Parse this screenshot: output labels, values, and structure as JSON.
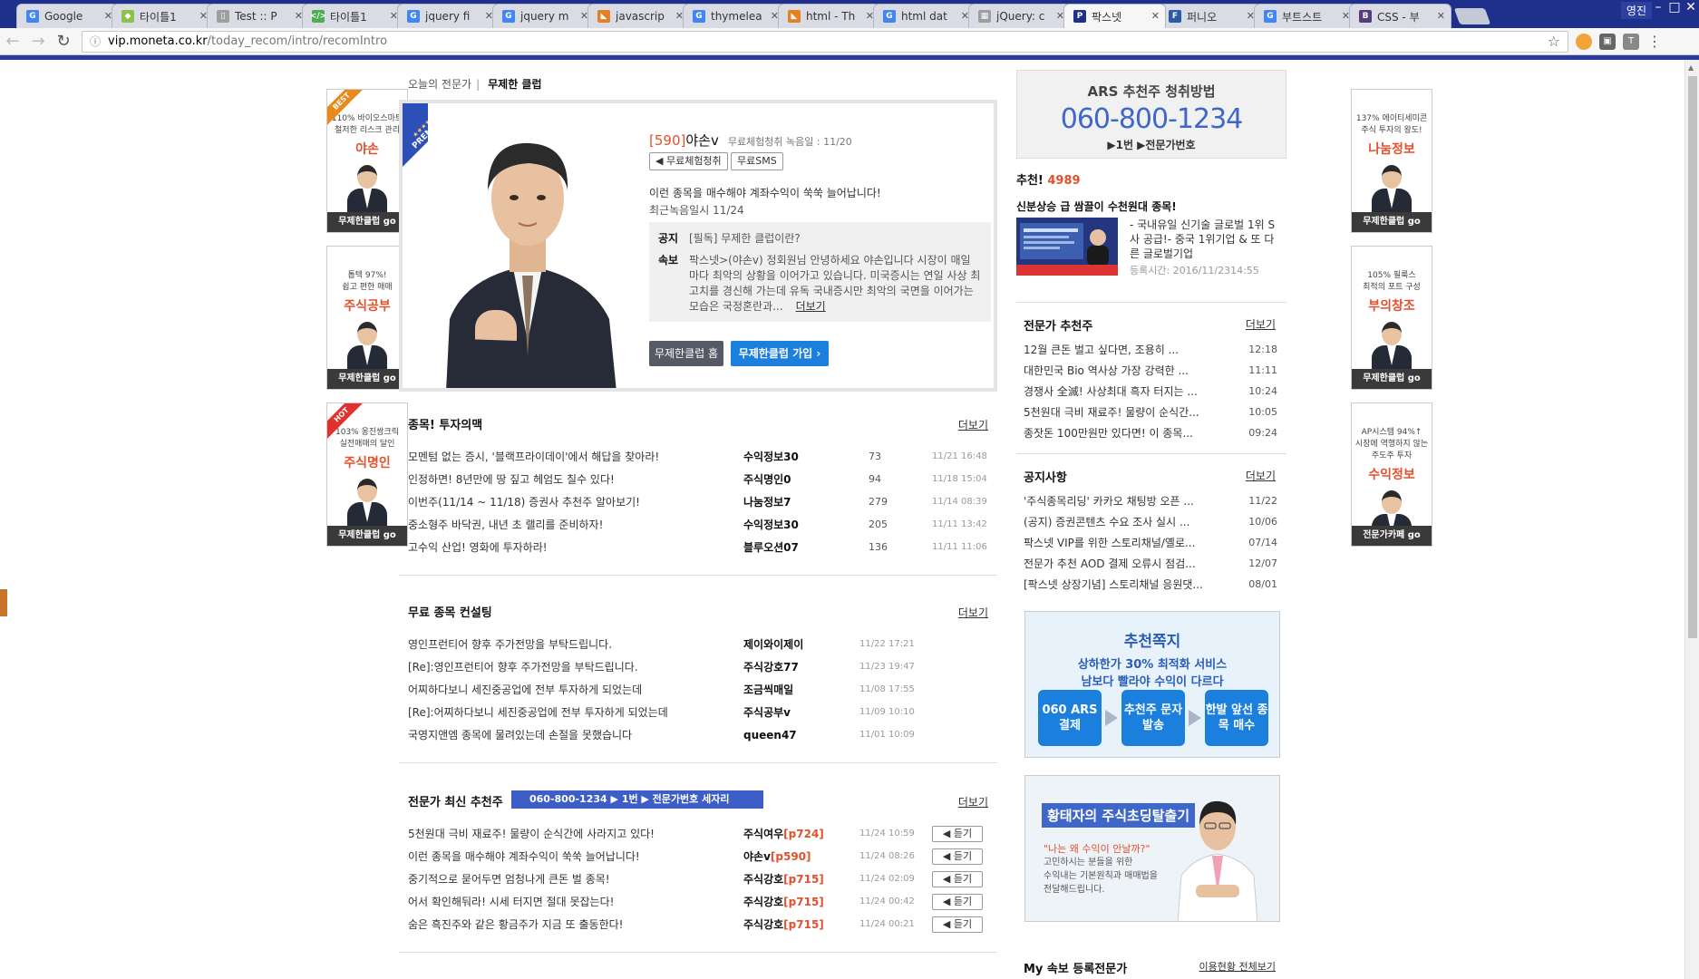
{
  "browser": {
    "tabs": [
      {
        "title": "Google",
        "icon": "G",
        "color": "#4285f4"
      },
      {
        "title": "타이틀1",
        "icon": "◆",
        "color": "#8bc34a"
      },
      {
        "title": "Test :: P",
        "icon": "▯",
        "color": "#9e9e9e"
      },
      {
        "title": "타이틀1",
        "icon": "</>",
        "color": "#4caf50"
      },
      {
        "title": "jquery fi",
        "icon": "G",
        "color": "#4285f4"
      },
      {
        "title": "jquery m",
        "icon": "G",
        "color": "#4285f4"
      },
      {
        "title": "javascrip",
        "icon": "◣",
        "color": "#e67e22"
      },
      {
        "title": "thymelea",
        "icon": "G",
        "color": "#4285f4"
      },
      {
        "title": "html - Th",
        "icon": "◣",
        "color": "#e67e22"
      },
      {
        "title": "html dat",
        "icon": "G",
        "color": "#4285f4"
      },
      {
        "title": "jQuery: c",
        "icon": "▦",
        "color": "#9e9e9e"
      },
      {
        "title": "팍스넷 ",
        "icon": "P",
        "color": "#1f2f8c",
        "active": true
      },
      {
        "title": "퍼니오 ",
        "icon": "F",
        "color": "#2b5aa8"
      },
      {
        "title": "부트스트",
        "icon": "G",
        "color": "#4285f4"
      },
      {
        "title": "CSS - 부",
        "icon": "B",
        "color": "#563d7c"
      }
    ],
    "profile": "영진",
    "url_host": "vip.moneta.co.kr",
    "url_path": "/today_recom/intro/recomIntro"
  },
  "breadcrumb": {
    "parent": "오늘의 전문가",
    "current": "무제한 클럽"
  },
  "side_left": [
    {
      "badge": "BEST",
      "badge_color": "#e88a1a",
      "line1": "110% 바이오스마트",
      "line2": "철저한 리스크 관리",
      "name": "야손",
      "go": "무제한클럽 go"
    },
    {
      "badge": "",
      "badge_color": "",
      "line1": "톱텍 97%!",
      "line2": "쉽고 편한 매매",
      "name": "주식공부",
      "go": "무제한클럽 go"
    },
    {
      "badge": "HOT",
      "badge_color": "#e2302d",
      "line1": "103% 옹진쌍크릭",
      "line2": "실전매매의 달인",
      "name": "주식명인",
      "go": "무제한클럽 go"
    }
  ],
  "side_right": [
    {
      "line1": "137% 에이티세미콘",
      "line2": "주식 투자의 왕도!",
      "name": "나눔정보",
      "go": "무제한클럽 go"
    },
    {
      "line1": "105% 필룩스",
      "line2": "최적의 포트 구성",
      "name": "부의창조",
      "go": "무제한클럽 go"
    },
    {
      "line1": "AP시스템 94%↑",
      "line2": "시장에 역행하지 않는 주도주 투자",
      "name": "수익정보",
      "go": "전문가카페 go"
    }
  ],
  "feature": {
    "premium": "PREMIUM",
    "stars": "★★★★★",
    "num": "[590]",
    "name": "야손v",
    "sub": "무료체험청취 녹음일 : 11/20",
    "btn_listen": "◀ 무료체험청취",
    "btn_sms": "무료SMS",
    "headline": "이런 종목을 매수해야 계좌수익이 쑥쑥 늘어납니다!",
    "recent": "최근녹음일시 11/24",
    "notice_k": "공지",
    "notice_v": "[필독] 무제한 클럽이란?",
    "flash_k": "속보",
    "flash_v": "팍스넷>(야손v) 정회원님 안녕하세요 야손입니다 시장이 매일 마다 최악의 상황을 이어가고 있습니다. 미국증시는 연일 사상 최고치를 경신해 가는데 유독 국내증시만 최악의 국면을 이어가는 모습은 국정혼란과...",
    "more": "더보기",
    "btn_home": "무제한클럽 홈",
    "btn_join": "무제한클럽 가입 ›"
  },
  "sections": {
    "picks": {
      "title": "종목! 투자의맥",
      "more": "더보기",
      "rows": [
        {
          "title": "모멘텀 없는 증시, '블랙프라이데이'에서 해답을 찾아라!",
          "author": "수익정보30",
          "count": "73",
          "date": "11/21 16:48"
        },
        {
          "title": "인정하면! 8년만에 땅 짚고 헤엄도 칠수 있다!",
          "author": "주식명인0",
          "count": "94",
          "date": "11/18 15:04"
        },
        {
          "title": "이번주(11/14 ~ 11/18) 증권사 추천주 알아보기!",
          "author": "나눔정보7",
          "count": "279",
          "date": "11/14 08:39"
        },
        {
          "title": "중소형주 바닥권, 내년 초 랠리를 준비하자!",
          "author": "수익정보30",
          "count": "205",
          "date": "11/11 13:42"
        },
        {
          "title": "고수익 산업! 영화에 투자하라!",
          "author": "블루오션07",
          "count": "136",
          "date": "11/11 11:06"
        }
      ]
    },
    "consult": {
      "title": "무료 종목 컨설팅",
      "more": "더보기",
      "rows": [
        {
          "title": "영인프런티어 향후 주가전망을 부탁드립니다.",
          "author": "제이와이제이",
          "date": "11/22 17:21"
        },
        {
          "title": "[Re]:영인프런티어 향후 주가전망을 부탁드립니다.",
          "author": "주식강호77",
          "date": "11/23 19:47"
        },
        {
          "title": "어찌하다보니 세진중공업에 전부 투자하게 되었는데",
          "author": "조금씩매일",
          "date": "11/08 17:55"
        },
        {
          "title": "[Re]:어찌하다보니 세진중공업에 전부 투자하게 되었는데",
          "author": "주식공부v",
          "date": "11/09 10:10"
        },
        {
          "title": "국영지앤엠 종목에 물려있는데 손절을 못했습니다",
          "author": "queen47",
          "date": "11/01 10:09"
        }
      ]
    },
    "latest": {
      "title": "전문가 최신 추천주",
      "ars_bar": "060-800-1234 ▶ 1번 ▶ 전문가번호 세자리",
      "more": "더보기",
      "play": "◀ 듣기",
      "rows": [
        {
          "title": "5천원대 극비 재료주! 물량이 순식간에 사라지고 있다!",
          "author": "주식여우",
          "code": "[p724]",
          "date": "11/24 10:59"
        },
        {
          "title": "이런 종목을 매수해야 계좌수익이 쑥쑥 늘어납니다!",
          "author": "야손v",
          "code": "[p590]",
          "date": "11/24 08:26"
        },
        {
          "title": "중기적으로 묻어두면 엄청나게 큰돈 벌 종목!",
          "author": "주식강호",
          "code": "[p715]",
          "date": "11/24 02:09"
        },
        {
          "title": "어서 확인해둬라! 시세 터지면 절대 못잡는다!",
          "author": "주식강호",
          "code": "[p715]",
          "date": "11/24 00:42"
        },
        {
          "title": "숨은 흑진주와 같은 황금주가 지금 또 출동한다!",
          "author": "주식강호",
          "code": "[p715]",
          "date": "11/24 00:21"
        }
      ]
    }
  },
  "ars": {
    "title": "ARS 추천주 청취방법",
    "phone": "060-800-1234",
    "steps": "▶1번  ▶전문가번호"
  },
  "recommend": {
    "label": "추천!",
    "count": "4989",
    "title": "신분상승 급 쌈끌이 수천원대 종목!",
    "desc": "- 국내유일 신기술 글로벌 1위 S사 공급!- 중국 1위기업 & 또 다른 글로벌기업",
    "date": "등록시간: 2016/11/2314:55"
  },
  "expert_picks": {
    "title": "전문가 추천주",
    "more": "더보기",
    "rows": [
      {
        "title": "12월 큰돈 벌고 싶다면, 조용히 ...",
        "time": "12:18"
      },
      {
        "title": "대한민국 Bio 역사상 가장 강력한 ...",
        "time": "11:11"
      },
      {
        "title": "경쟁사 全滅! 사상최대 흑자 터지는 ...",
        "time": "10:24"
      },
      {
        "title": "5천원대 극비 재료주! 물량이 순식간...",
        "time": "10:05"
      },
      {
        "title": "종잣돈 100만원만 있다면! 이 종목...",
        "time": "09:24"
      }
    ]
  },
  "notices": {
    "title": "공지사항",
    "more": "더보기",
    "rows": [
      {
        "title": "'주식종목리딩' 카카오 채팅방 오픈 ...",
        "date": "11/22"
      },
      {
        "title": "(공지) 증권콘텐츠 수요 조사 실시 ...",
        "date": "10/06"
      },
      {
        "title": "팍스넷 VIP를 위한 스토리채널/옐로...",
        "date": "07/14"
      },
      {
        "title": "전문가 추천 AOD 결제 오류시 점검...",
        "date": "12/07"
      },
      {
        "title": "[팍스넷 상장기념] 스토리채널 응원댓...",
        "date": "08/01"
      }
    ]
  },
  "promo1": {
    "title": "추천쪽지",
    "sub1": "상하한가 30% 최적화 서비스",
    "sub2": "남보다 빨라야 수익이 다르다",
    "step1": "060 ARS 결제",
    "step2": "추천주 문자발송",
    "step3": "한발 앞선 종목 매수"
  },
  "promo2": {
    "title": "황태자의 주식초딩탈출기",
    "quote": "\"나는 왜 수익이 안날까?\"",
    "body1": "고민하시는 분들을 위한",
    "body2": "수익내는 기본원칙과 매매법을",
    "body3": "전달해드립니다."
  },
  "my_flash": {
    "title": "My 속보 등록전문가",
    "link": "이용현황 전체보기"
  },
  "colors": {
    "accent_blue": "#3e67c9",
    "accent_red": "#e2502d",
    "dark_button": "#555a66",
    "join_button": "#1b7fde",
    "chrome": "#1f2f8c"
  }
}
